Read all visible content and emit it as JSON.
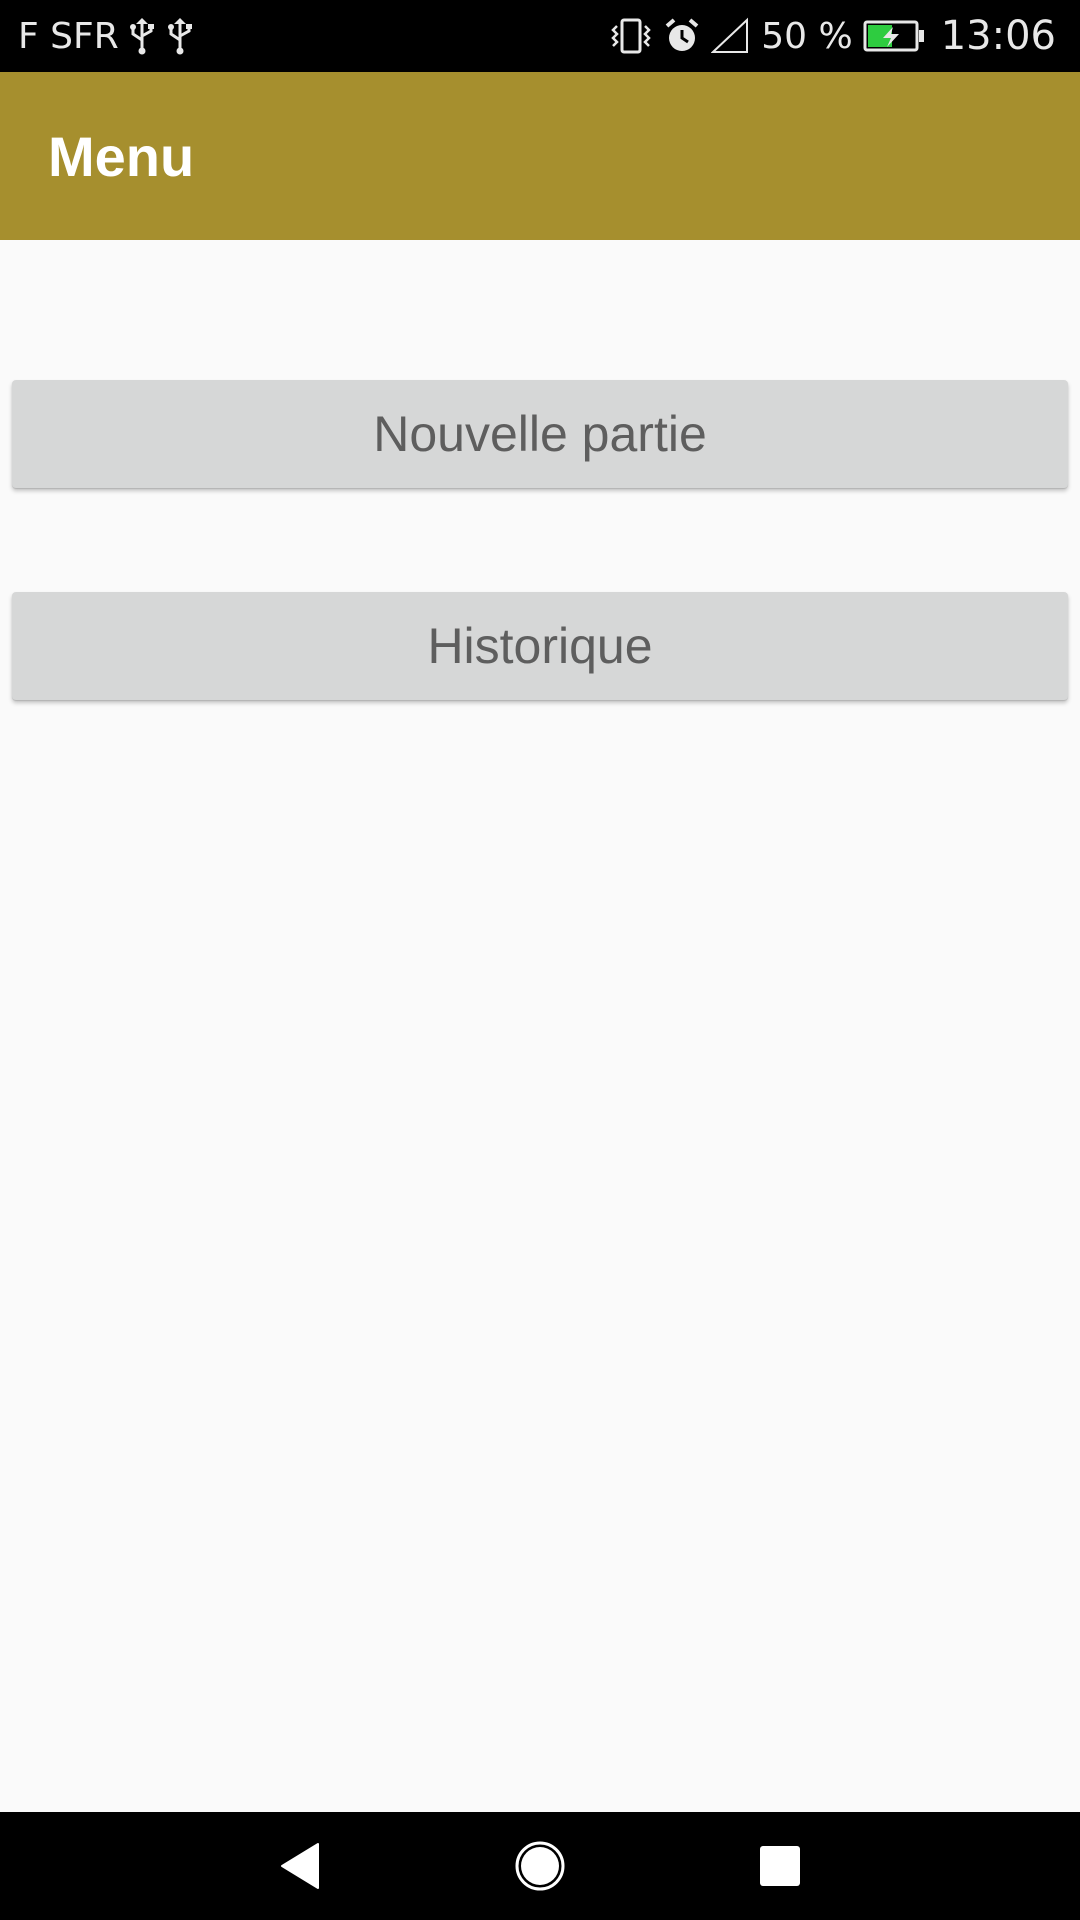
{
  "status_bar": {
    "carrier": "F SFR",
    "battery_percent": "50 %",
    "time": "13:06",
    "icons_left": [
      "usb-icon",
      "usb-icon"
    ],
    "icons_right": [
      "vibrate-icon",
      "alarm-icon",
      "signal-icon",
      "battery-charging-icon"
    ]
  },
  "app_bar": {
    "title": "Menu",
    "color": "#a68f2e"
  },
  "main": {
    "buttons": [
      {
        "label": "Nouvelle partie"
      },
      {
        "label": "Historique"
      }
    ]
  },
  "nav_bar": {
    "icons": [
      "back-icon",
      "home-icon",
      "recents-icon"
    ]
  }
}
